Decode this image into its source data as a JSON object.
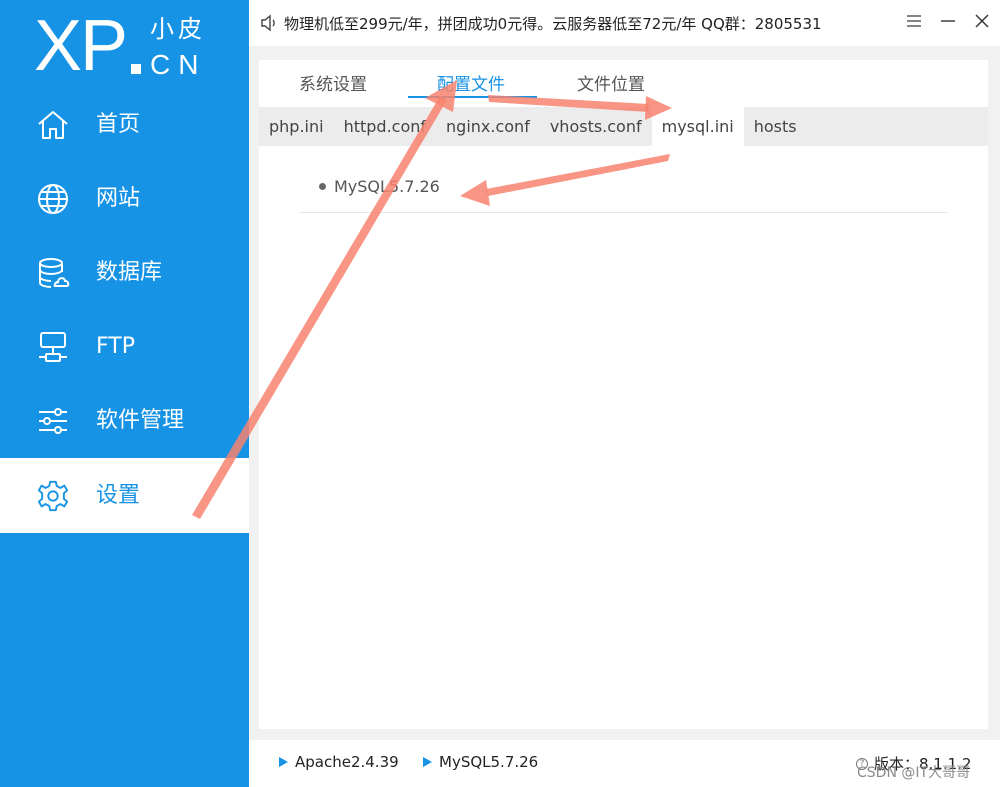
{
  "logo": {
    "mark": "XP",
    "cn_top": "小皮",
    "cn_bottom": "CN"
  },
  "sidebar": {
    "items": [
      {
        "label": "首页",
        "icon": "home-icon"
      },
      {
        "label": "网站",
        "icon": "globe-icon"
      },
      {
        "label": "数据库",
        "icon": "database-icon"
      },
      {
        "label": "FTP",
        "icon": "ftp-icon"
      },
      {
        "label": "软件管理",
        "icon": "sliders-icon"
      },
      {
        "label": "设置",
        "icon": "gear-icon",
        "active": true
      }
    ]
  },
  "topbar": {
    "notice": "物理机低至299元/年，拼团成功0元得。云服务器低至72元/年 QQ群：2805531"
  },
  "main": {
    "tabs": [
      {
        "label": "系统设置"
      },
      {
        "label": "配置文件",
        "active": true
      },
      {
        "label": "文件位置"
      }
    ],
    "subtabs": [
      {
        "label": "php.ini"
      },
      {
        "label": "httpd.conf"
      },
      {
        "label": "nginx.conf"
      },
      {
        "label": "vhosts.conf"
      },
      {
        "label": "mysql.ini",
        "active": true
      },
      {
        "label": "hosts"
      }
    ],
    "list": [
      {
        "label": "MySQL5.7.26"
      }
    ]
  },
  "bottombar": {
    "services": [
      {
        "label": "Apache2.4.39"
      },
      {
        "label": "MySQL5.7.26"
      }
    ],
    "version": "版本：8.1.1.2",
    "watermark": "CSDN @IT大哥哥"
  },
  "colors": {
    "accent": "#1793e6",
    "annotation": "#f7826f"
  }
}
